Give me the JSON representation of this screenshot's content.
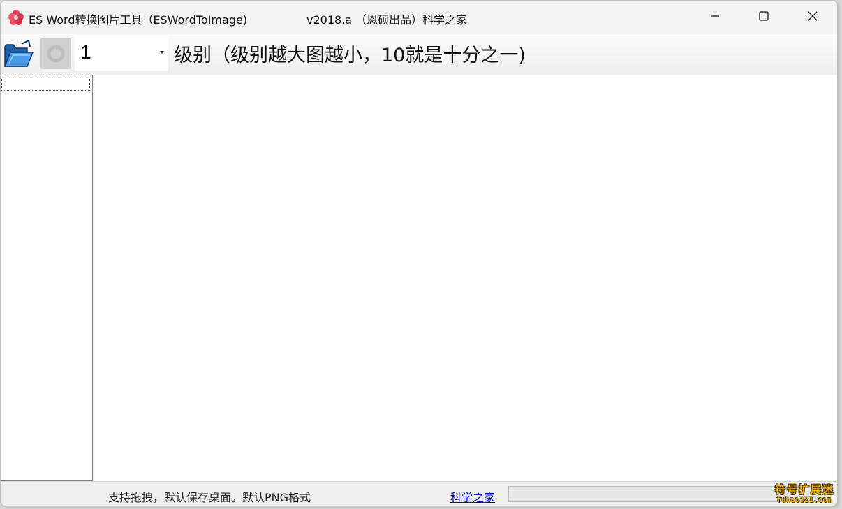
{
  "window": {
    "title": "ES Word转换图片工具（ESWordToImage)",
    "version_info": "v2018.a （恩硕出品）科学之家",
    "icons": {
      "app": "flower-app-icon",
      "minimize": "minimize-icon",
      "maximize": "maximize-icon",
      "close": "close-icon"
    }
  },
  "toolbar": {
    "open_icon": "folder-open-icon",
    "convert_icon": "convert-icon",
    "level_value": "1",
    "level_label": "级别（级别越大图越小，10就是十分之一)"
  },
  "statusbar": {
    "hint": "支持拖拽，默认保存桌面。默认PNG格式",
    "link": "科学之家"
  },
  "watermark": {
    "top": "符号扩展迷",
    "bottom": "fuhao321.com"
  },
  "colors": {
    "link": "#0000ee",
    "app_icon": "#e8405a",
    "folder": "#2f7fd6"
  }
}
